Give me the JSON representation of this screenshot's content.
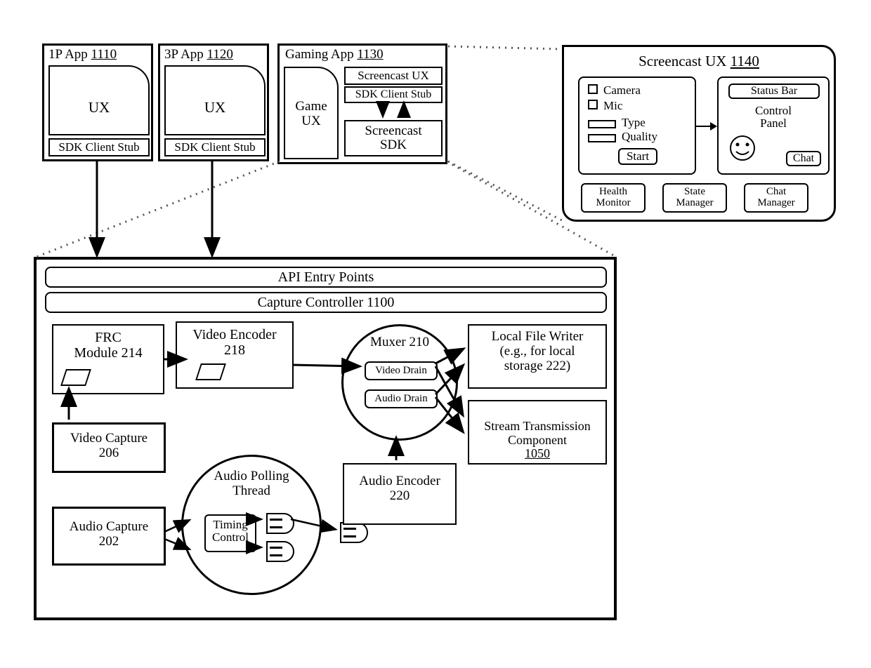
{
  "apps": {
    "app1": {
      "title": "1P App",
      "num": "1110",
      "ux": "UX",
      "stub": "SDK Client Stub"
    },
    "app3": {
      "title": "3P App",
      "num": "1120",
      "ux": "UX",
      "stub": "SDK Client Stub"
    },
    "gaming": {
      "title": "Gaming App",
      "num": "1130",
      "ux": "Game\nUX",
      "scx": "Screencast UX",
      "stub": "SDK Client Stub",
      "sdk": "Screencast\nSDK"
    }
  },
  "screencast": {
    "title": "Screencast UX",
    "num": "1140",
    "camera": "Camera",
    "mic": "Mic",
    "type": "Type",
    "quality": "Quality",
    "start": "Start",
    "status_bar": "Status Bar",
    "control_panel": "Control\nPanel",
    "chat": "Chat",
    "health": "Health\nMonitor",
    "state": "State\nManager",
    "chatmgr": "Chat\nManager"
  },
  "controller": {
    "api": "API Entry Points",
    "title": "Capture Controller 1100",
    "frc": "FRC\nModule 214",
    "video_enc": "Video Encoder\n218",
    "video_cap": "Video Capture\n206",
    "audio_cap": "Audio Capture\n202",
    "audio_poll": "Audio Polling\nThread",
    "timing": "Timing\nControl",
    "muxer": "Muxer 210",
    "video_drain": "Video Drain",
    "audio_drain": "Audio Drain",
    "audio_enc": "Audio Encoder\n220",
    "local_writer": "Local File Writer\n(e.g., for local\nstorage 222)",
    "stream": "Stream Transmission\nComponent",
    "stream_num": "1050"
  }
}
